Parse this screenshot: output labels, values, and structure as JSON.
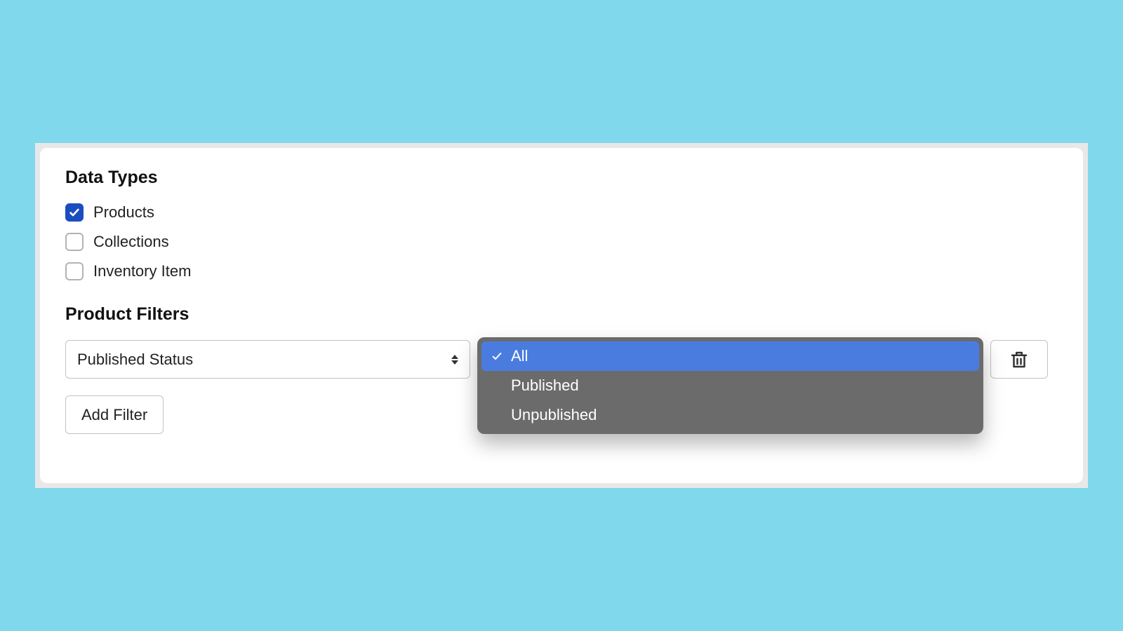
{
  "sections": {
    "data_types_heading": "Data Types",
    "product_filters_heading": "Product Filters"
  },
  "data_types": {
    "items": [
      {
        "label": "Products",
        "checked": true
      },
      {
        "label": "Collections",
        "checked": false
      },
      {
        "label": "Inventory Item",
        "checked": false
      }
    ]
  },
  "filters": {
    "field_select_value": "Published Status",
    "value_select_value": "All",
    "dropdown_options": [
      {
        "label": "All",
        "selected": true
      },
      {
        "label": "Published",
        "selected": false
      },
      {
        "label": "Unpublished",
        "selected": false
      }
    ]
  },
  "buttons": {
    "add_filter": "Add Filter"
  },
  "icons": {
    "check": "check-icon",
    "sort": "sort-icon",
    "trash": "trash-icon"
  },
  "colors": {
    "page_bg": "#80d8ed",
    "accent": "#1a4ec0",
    "dropdown_bg": "#6b6b6b",
    "dropdown_selected": "#4a7ce0"
  }
}
